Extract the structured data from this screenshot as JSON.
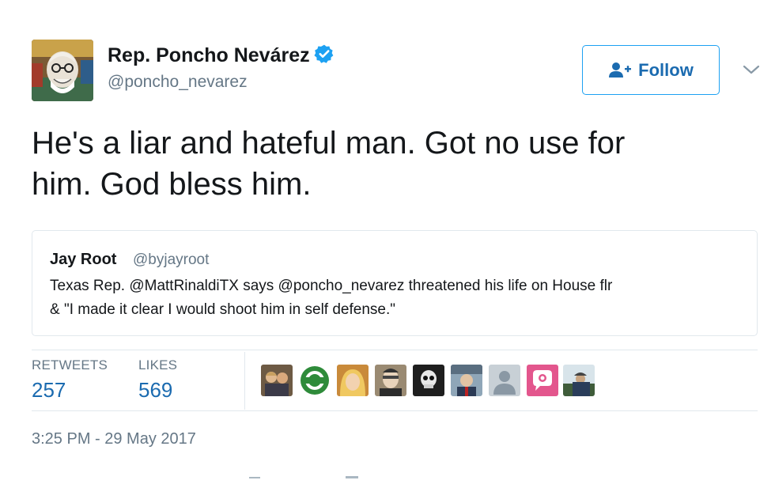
{
  "author": {
    "name": "Rep. Poncho Nevárez",
    "handle": "@poncho_nevarez",
    "verified": true,
    "verified_icon": "verified-badge-icon"
  },
  "follow_button": {
    "label": "Follow",
    "icon": "add-user-icon"
  },
  "caret_icon": "chevron-down-icon",
  "tweet": {
    "text_line1": "He's a liar and hateful man. Got no use for",
    "text_line2": "him. God bless him."
  },
  "quoted_tweet": {
    "name": "Jay Root",
    "handle": "@byjayroot",
    "text_line1": "Texas Rep. @MattRinaldiTX says @poncho_nevarez threatened his life on House flr",
    "text_line2": "& \"I made it clear I would shoot him in self defense.\""
  },
  "stats": {
    "retweets_label": "RETWEETS",
    "retweets_value": "257",
    "likes_label": "LIKES",
    "likes_value": "569"
  },
  "timestamp": "3:25 PM - 29 May 2017",
  "colors": {
    "accent": "#1da1f2",
    "link": "#1b6bb0",
    "secondary_text": "#657786",
    "border": "#e1e8ed"
  }
}
